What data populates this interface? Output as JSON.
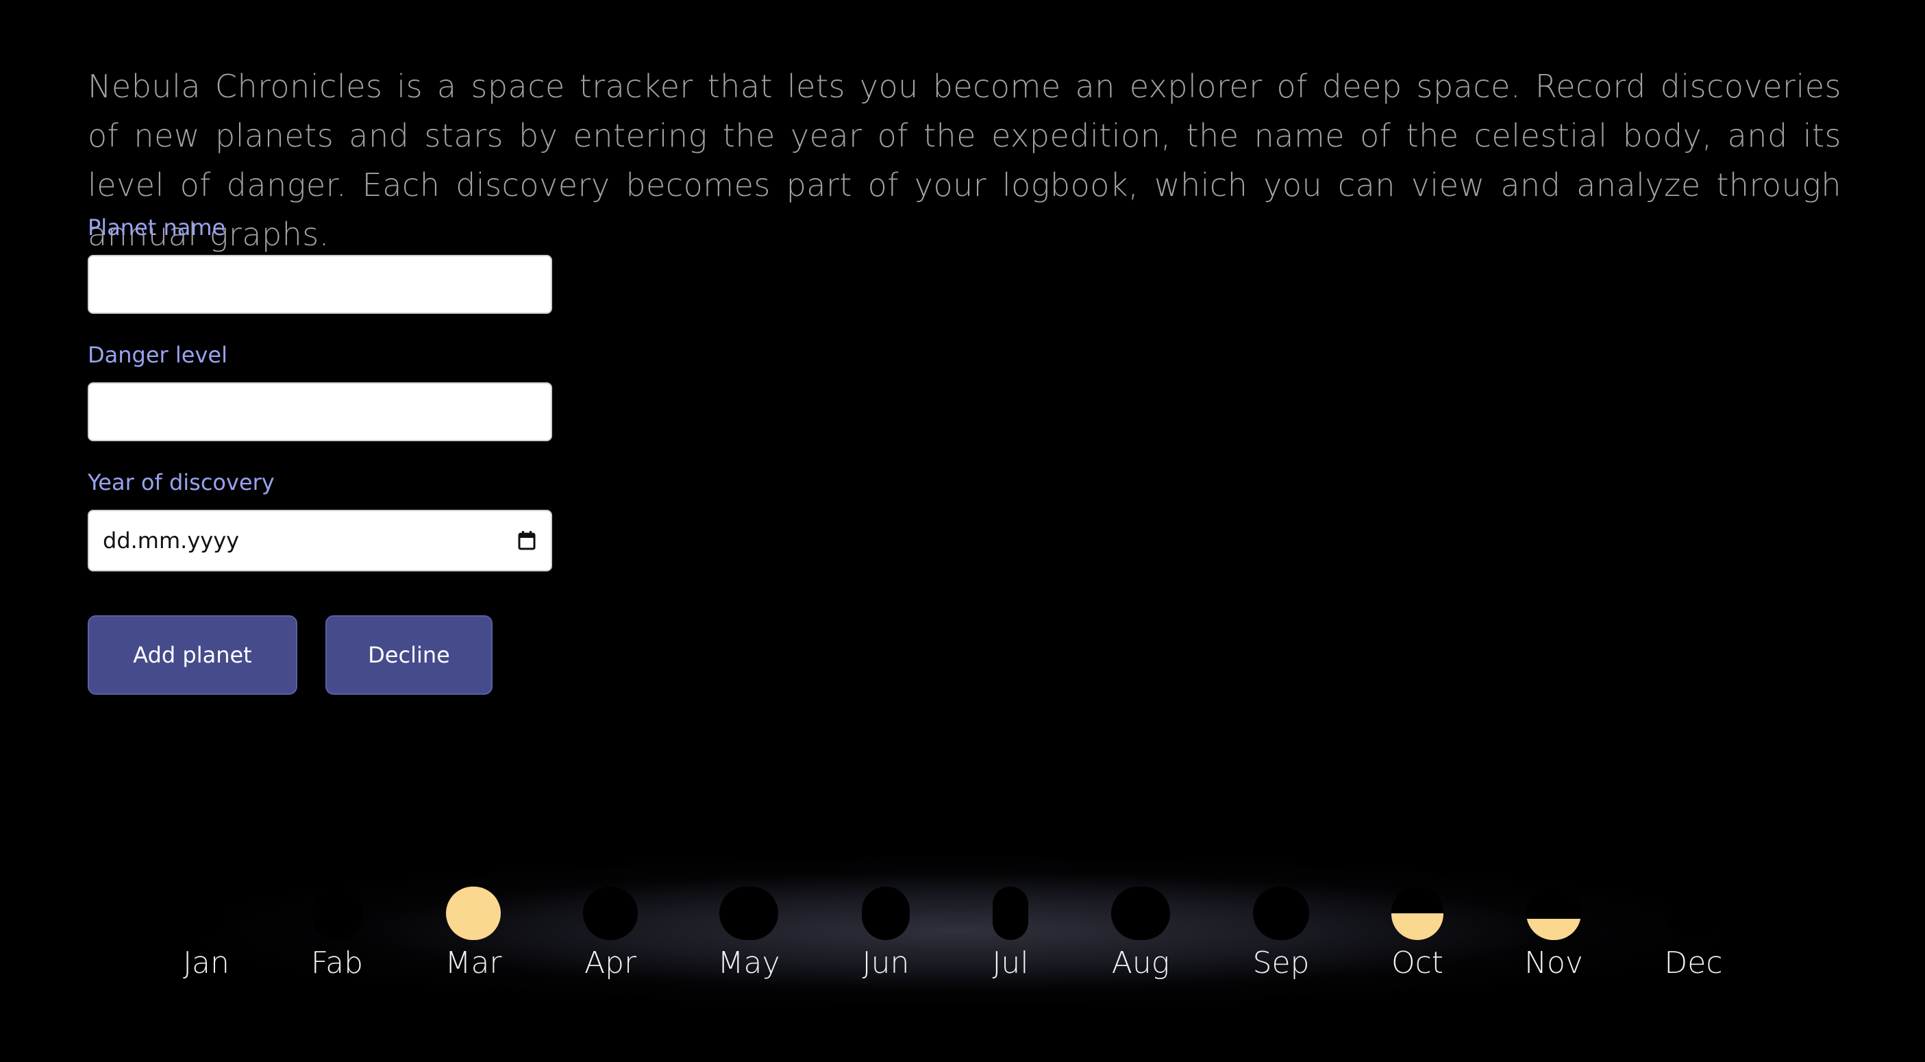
{
  "intro": {
    "text": "Nebula Chronicles is a space tracker that lets you become an explorer of deep space. Record discoveries of new planets and stars by entering the year of the expedition, the name of the celestial body, and its level of danger. Each discovery becomes part of your logbook, which you can view and analyze through annual graphs."
  },
  "form": {
    "planet_name_label": "Planet name",
    "planet_name_value": "",
    "danger_level_label": "Danger level",
    "danger_level_value": "",
    "year_label": "Year of discovery",
    "year_placeholder": "dd.mm.yyyy"
  },
  "buttons": {
    "add_label": "Add planet",
    "decline_label": "Decline"
  },
  "colors": {
    "background": "#000000",
    "intro_text": "#a3a3a3",
    "label_text": "#9aa2f0",
    "button_bg": "#464b8c",
    "month_fill": "#fbd88f"
  },
  "calendar": {
    "months": [
      {
        "label": "Jan",
        "fill": 0
      },
      {
        "label": "Fab",
        "fill": 0
      },
      {
        "label": "Mar",
        "fill": 1
      },
      {
        "label": "Apr",
        "fill": 0
      },
      {
        "label": "May",
        "fill": 0
      },
      {
        "label": "Jun",
        "fill": 0
      },
      {
        "label": "Jul",
        "fill": 0
      },
      {
        "label": "Aug",
        "fill": 0
      },
      {
        "label": "Sep",
        "fill": 0
      },
      {
        "label": "Oct",
        "fill": 0.5
      },
      {
        "label": "Nov",
        "fill": 0.4
      },
      {
        "label": "Dec",
        "fill": 0
      }
    ]
  }
}
